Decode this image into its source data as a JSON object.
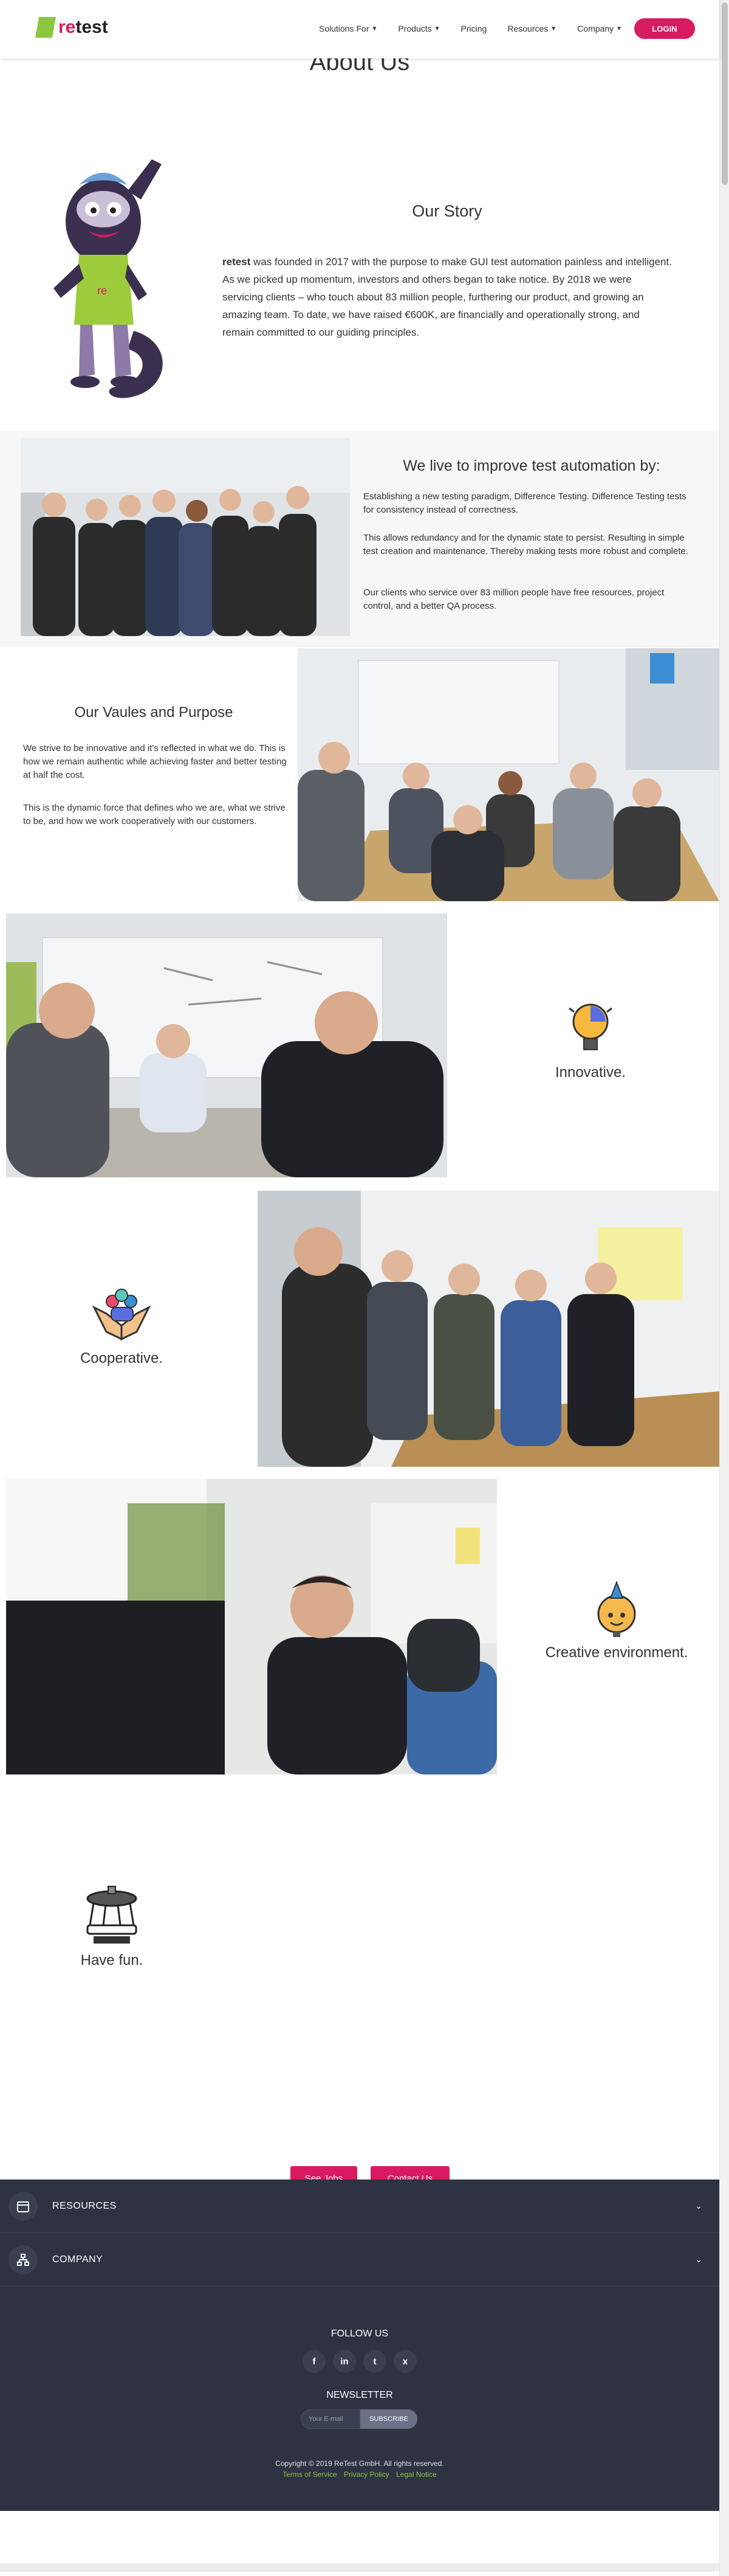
{
  "header": {
    "logo_text_re": "re",
    "logo_text_test": "test",
    "nav": [
      {
        "label": "Solutions For",
        "dropdown": true
      },
      {
        "label": "Products",
        "dropdown": true
      },
      {
        "label": "Pricing",
        "dropdown": false
      },
      {
        "label": "Resources",
        "dropdown": true
      },
      {
        "label": "Company",
        "dropdown": true
      }
    ],
    "login_label": "LOGIN"
  },
  "page_title": "About Us",
  "story": {
    "title": "Our Story",
    "brand": "retest",
    "text": " was founded in 2017 with the purpose to make GUI test automation painless and intelligent. As we picked up momentum, investors and others began to take notice. By 2018 we were servicing clients – who touch about 83 million people, furthering our product, and growing an amazing team. To date, we have raised €600K, are financially and operationally strong, and remain committed to our guiding principles."
  },
  "improve": {
    "title": "We live to improve test automation by:",
    "paragraphs": [
      "Establishing a new testing paradigm, Difference Testing. Difference Testing tests for consistency instead of correctness.",
      "This allows redundancy and for the dynamic state to persist. Resulting in simple test creation and maintenance. Thereby making tests more robust and complete.",
      "Our clients who service over 83 million people have free resources, project control, and a better QA process."
    ]
  },
  "values": {
    "title": "Our Vaules and Purpose",
    "paragraphs": [
      "We strive to be innovative and it's reflected in what we do. This is how we remain authentic while achieving faster and better testing at half the cost.",
      "This is the dynamic force that defines who we are, what we strive to be, and how we work cooperatively with our customers."
    ]
  },
  "features": {
    "innovative": "Innovative.",
    "cooperative": "Cooperative.",
    "creative": "Creative environment.",
    "fun": "Have fun."
  },
  "cta": {
    "jobs": "See Jobs",
    "contact": "Contact Us"
  },
  "footer": {
    "resources": "RESOURCES",
    "company": "COMPANY",
    "follow": "FOLLOW US",
    "socials": [
      {
        "name": "facebook-icon",
        "glyph": "f"
      },
      {
        "name": "linkedin-icon",
        "glyph": "in"
      },
      {
        "name": "twitter-icon",
        "glyph": "t"
      },
      {
        "name": "xing-icon",
        "glyph": "x"
      }
    ],
    "newsletter": "NEWSLETTER",
    "email_placeholder": "Your E-mail",
    "subscribe": "SUBSCRIBE",
    "copyright": "Copyright © 2019 ReTest GmbH. All rights reserved.",
    "links": [
      "Terms of Service",
      "Privacy Policy",
      "Legal Notice"
    ]
  },
  "colors": {
    "brand_pink": "#d81b60",
    "brand_green": "#8cc63f",
    "footer_bg": "#2e3242"
  }
}
